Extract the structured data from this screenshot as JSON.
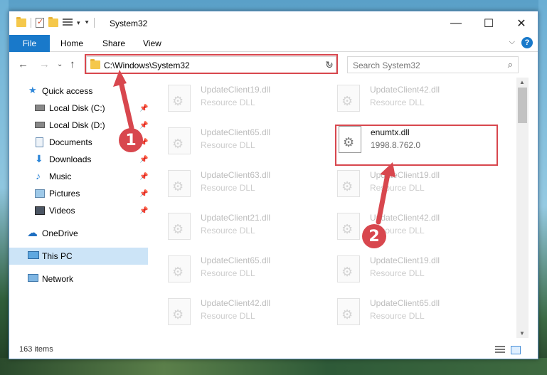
{
  "window": {
    "title": "System32",
    "controls": {
      "minimize": "—",
      "maximize": "☐",
      "close": "✕"
    }
  },
  "ribbon": {
    "tabs": [
      "File",
      "Home",
      "Share",
      "View"
    ],
    "help": "?"
  },
  "navigation": {
    "address": "C:\\Windows\\System32",
    "search_placeholder": "Search System32"
  },
  "sidebar": {
    "items": [
      {
        "label": "Quick access",
        "icon": "star-icon",
        "pinned": false
      },
      {
        "label": "Local Disk (C:)",
        "icon": "drive-icon",
        "pinned": true
      },
      {
        "label": "Local Disk (D:)",
        "icon": "drive-icon",
        "pinned": true
      },
      {
        "label": "Documents",
        "icon": "documents-icon",
        "pinned": true
      },
      {
        "label": "Downloads",
        "icon": "download-icon",
        "pinned": true
      },
      {
        "label": "Music",
        "icon": "music-icon",
        "pinned": true
      },
      {
        "label": "Pictures",
        "icon": "pictures-icon",
        "pinned": true
      },
      {
        "label": "Videos",
        "icon": "videos-icon",
        "pinned": true
      },
      {
        "label": "OneDrive",
        "icon": "cloud-icon",
        "pinned": false
      },
      {
        "label": "This PC",
        "icon": "computer-icon",
        "pinned": false,
        "selected": true
      },
      {
        "label": "Network",
        "icon": "network-icon",
        "pinned": false
      }
    ]
  },
  "files": {
    "left": [
      {
        "name": "UpdateClient19.dll",
        "desc": "Resource DLL"
      },
      {
        "name": "UpdateClient65.dll",
        "desc": "Resource DLL"
      },
      {
        "name": "UpdateClient63.dll",
        "desc": "Resource DLL"
      },
      {
        "name": "UpdateClient21.dll",
        "desc": "Resource DLL"
      },
      {
        "name": "UpdateClient65.dll",
        "desc": "Resource DLL"
      },
      {
        "name": "UpdateClient42.dll",
        "desc": "Resource DLL"
      }
    ],
    "right": [
      {
        "name": "UpdateClient42.dll",
        "desc": "Resource DLL"
      },
      {
        "name": "enumtx.dll",
        "desc": "1998.8.762.0",
        "active": true
      },
      {
        "name": "UpdateClient19.dll",
        "desc": "Resource DLL"
      },
      {
        "name": "UpdateClient42.dll",
        "desc": "Resource DLL"
      },
      {
        "name": "UpdateClient19.dll",
        "desc": "Resource DLL"
      },
      {
        "name": "UpdateClient65.dll",
        "desc": "Resource DLL"
      }
    ]
  },
  "status": {
    "item_count": "163 items"
  },
  "annotations": {
    "step1": "1",
    "step2": "2"
  },
  "colors": {
    "accent": "#1979ca",
    "highlight": "#d8474e",
    "selected": "#cce4f7"
  }
}
